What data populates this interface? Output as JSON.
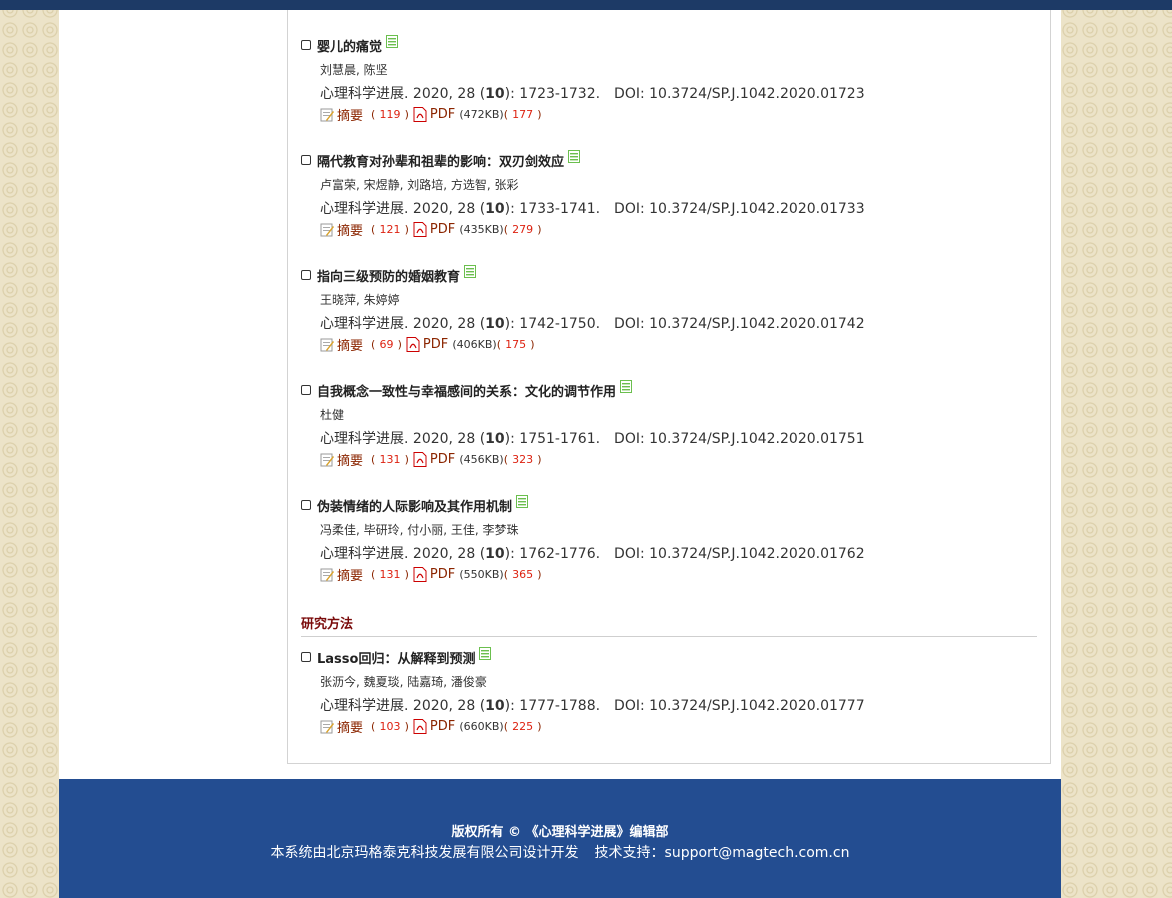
{
  "colors": {
    "topbar": "#1d3a66",
    "footer_bg": "#234d91",
    "link": "#8b2500",
    "count": "#dd2211",
    "section_heading": "#7a0b0b"
  },
  "icons": {
    "list": "list-icon",
    "abstract": "abstract-icon",
    "pdf": "pdf-icon"
  },
  "articles": [
    {
      "title": "婴儿的痛觉",
      "authors": "刘慧晨, 陈坚",
      "journal": "心理科学进展",
      "year_volume": "2020, 28 (",
      "issue": "10",
      "pages": "): 1723-1732.",
      "doi": "DOI: 10.3724/SP.J.1042.2020.01723",
      "abstract_label": "摘要",
      "abstract_count": "119",
      "pdf_label": "PDF",
      "pdf_size": "(472KB)",
      "pdf_count": "177"
    },
    {
      "title": "隔代教育对孙辈和祖辈的影响：双刃剑效应",
      "authors": "卢富荣, 宋煜静, 刘路培, 方选智, 张彩",
      "journal": "心理科学进展",
      "year_volume": "2020, 28 (",
      "issue": "10",
      "pages": "): 1733-1741.",
      "doi": "DOI: 10.3724/SP.J.1042.2020.01733",
      "abstract_label": "摘要",
      "abstract_count": "121",
      "pdf_label": "PDF",
      "pdf_size": "(435KB)",
      "pdf_count": "279"
    },
    {
      "title": "指向三级预防的婚姻教育",
      "authors": "王晓萍, 朱婷婷",
      "journal": "心理科学进展",
      "year_volume": "2020, 28 (",
      "issue": "10",
      "pages": "): 1742-1750.",
      "doi": "DOI: 10.3724/SP.J.1042.2020.01742",
      "abstract_label": "摘要",
      "abstract_count": "69",
      "pdf_label": "PDF",
      "pdf_size": "(406KB)",
      "pdf_count": "175"
    },
    {
      "title": "自我概念一致性与幸福感间的关系：文化的调节作用",
      "authors": "杜健",
      "journal": "心理科学进展",
      "year_volume": "2020, 28 (",
      "issue": "10",
      "pages": "): 1751-1761.",
      "doi": "DOI: 10.3724/SP.J.1042.2020.01751",
      "abstract_label": "摘要",
      "abstract_count": "131",
      "pdf_label": "PDF",
      "pdf_size": "(456KB)",
      "pdf_count": "323"
    },
    {
      "title": "伪装情绪的人际影响及其作用机制",
      "authors": "冯柔佳, 毕研玲, 付小丽, 王佳, 李梦珠",
      "journal": "心理科学进展",
      "year_volume": "2020, 28 (",
      "issue": "10",
      "pages": "): 1762-1776.",
      "doi": "DOI: 10.3724/SP.J.1042.2020.01762",
      "abstract_label": "摘要",
      "abstract_count": "131",
      "pdf_label": "PDF",
      "pdf_size": "(550KB)",
      "pdf_count": "365"
    },
    {
      "title": "Lasso回归：从解释到预测",
      "authors": "张沥今, 魏夏琰, 陆嘉琦, 潘俊豪",
      "journal": "心理科学进展",
      "year_volume": "2020, 28 (",
      "issue": "10",
      "pages": "): 1777-1788.",
      "doi": "DOI: 10.3724/SP.J.1042.2020.01777",
      "abstract_label": "摘要",
      "abstract_count": "103",
      "pdf_label": "PDF",
      "pdf_size": "(660KB)",
      "pdf_count": "225"
    }
  ],
  "section": {
    "title": "研究方法"
  },
  "footer": {
    "copyright": "版权所有 © 《心理科学进展》编辑部",
    "developer": "本系统由北京玛格泰克科技发展有限公司设计开发",
    "support": "技术支持：support@magtech.com.cn"
  }
}
